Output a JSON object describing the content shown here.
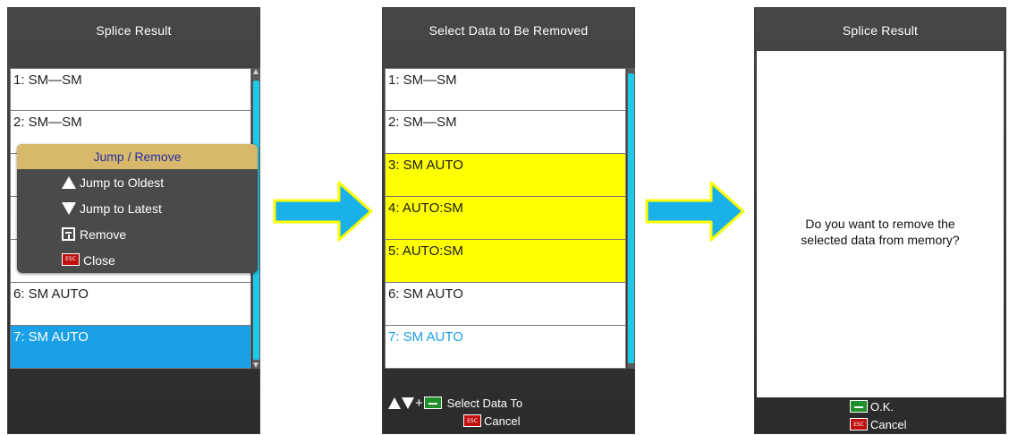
{
  "screen1": {
    "title": "Splice Result",
    "rows": [
      {
        "label": "1: SM—SM",
        "style": "white"
      },
      {
        "label": "2: SM—SM",
        "style": "white"
      },
      {
        "label": "",
        "style": "white"
      },
      {
        "label": "",
        "style": "white"
      },
      {
        "label": "",
        "style": "white"
      },
      {
        "label": "6: SM AUTO",
        "style": "white"
      },
      {
        "label": "7: SM AUTO",
        "style": "blue-bg"
      }
    ],
    "popup": {
      "header": "Jump / Remove",
      "items": [
        {
          "icon": "triangle-up-icon",
          "label": "Jump to Oldest"
        },
        {
          "icon": "triangle-down-icon",
          "label": "Jump to Latest"
        },
        {
          "icon": "remove-icon",
          "label": "Remove"
        },
        {
          "icon": "esc-icon",
          "label": "Close"
        }
      ]
    }
  },
  "screen2": {
    "title": "Select Data to Be Removed",
    "rows": [
      {
        "label": "1: SM—SM",
        "style": "white"
      },
      {
        "label": "2: SM—SM",
        "style": "white"
      },
      {
        "label": "3: SM AUTO",
        "style": "yellow"
      },
      {
        "label": "4: AUTO:SM",
        "style": "yellow"
      },
      {
        "label": "5: AUTO:SM",
        "style": "yellow"
      },
      {
        "label": "6: SM AUTO",
        "style": "white"
      },
      {
        "label": "7: SM AUTO",
        "style": "blue-text"
      }
    ],
    "footer": {
      "select_label": "Select Data To",
      "cancel_label": "Cancel",
      "plus": "+"
    }
  },
  "screen3": {
    "title": "Splice Result",
    "message_line1": "Do you want to remove the",
    "message_line2": "selected data from memory?",
    "footer": {
      "ok_label": "O.K.",
      "cancel_label": "Cancel"
    }
  },
  "colors": {
    "highlight_yellow": "#ffff00",
    "selected_blue": "#1aa0e6",
    "scroll_cyan": "#1ec8e8",
    "popup_header": "#d8b86a",
    "arrow_fill": "#1ab0e8",
    "arrow_outline": "#ffff00"
  }
}
